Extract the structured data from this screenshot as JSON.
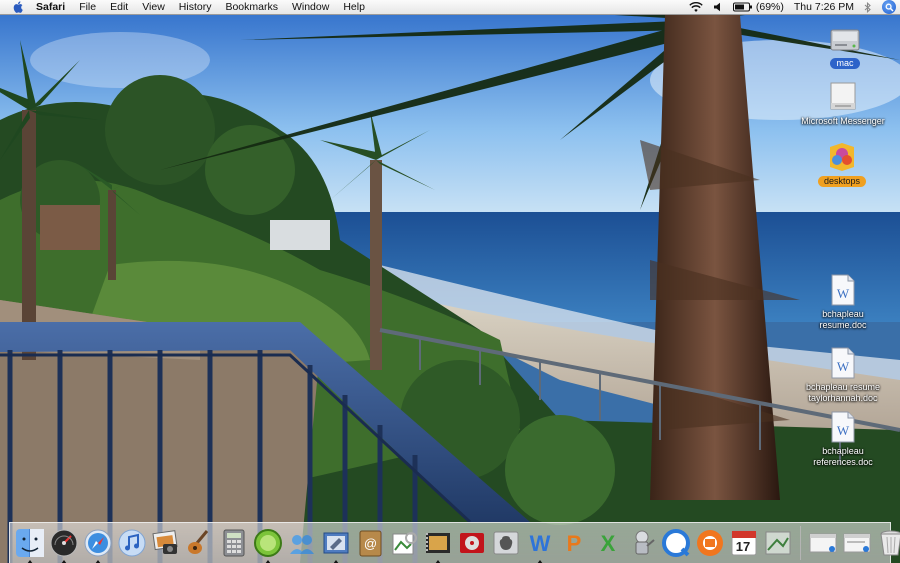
{
  "menubar": {
    "app_name": "Safari",
    "menus": [
      "File",
      "Edit",
      "View",
      "History",
      "Bookmarks",
      "Window",
      "Help"
    ],
    "battery_text": "(69%)",
    "clock": "Thu 7:26 PM"
  },
  "desktop_icons": [
    {
      "label": "mac",
      "icon": "hard-drive-icon",
      "selected": "blue"
    },
    {
      "label": "Microsoft Messenger",
      "icon": "disk-image-icon"
    },
    {
      "label": "desktops",
      "icon": "folder-icon",
      "selected": "orange"
    },
    {
      "label": "bchapleau\nresume.doc",
      "icon": "word-document-icon"
    },
    {
      "label": "bchapleau resume\ntaylorhannah.doc",
      "icon": "word-document-icon"
    },
    {
      "label": "bchapleau\nreferences.doc",
      "icon": "word-document-icon"
    }
  ],
  "dock": {
    "apps": [
      "Finder",
      "Dashboard",
      "Safari",
      "iTunes",
      "iPhoto",
      "GarageBand",
      "Calculator",
      "LimeWire",
      "iChat",
      "Mail",
      "Address Book",
      "Preview",
      "iMovie",
      "DVD Player",
      "System Preferences",
      "Microsoft Word",
      "Microsoft PowerPoint",
      "Microsoft Excel",
      "Automator",
      "QuickTime Player",
      "Timbuktu",
      "iCal",
      "Grab"
    ],
    "calendar_day": "17",
    "colors": {
      "accent": "#2d63c9",
      "folder": "#f0a020"
    }
  }
}
